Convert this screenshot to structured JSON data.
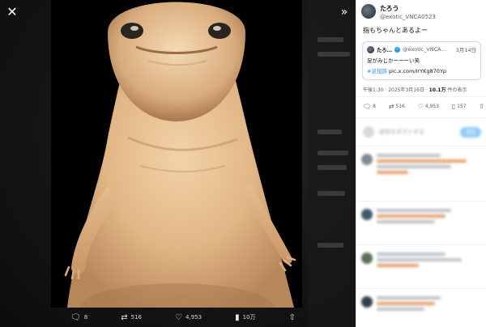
{
  "viewer": {
    "close_icon": "close-icon",
    "expand_icon": "chevron-right-double-icon",
    "media_actions": {
      "replies": "8",
      "retweets": "516",
      "likes": "4,953",
      "views": "10万"
    }
  },
  "sidebar": {
    "author": {
      "name": "たろう",
      "handle": "@exotic_VNCA0523"
    },
    "tweet_text": "指もちゃんとあるよー",
    "quote": {
      "name": "たろ…",
      "handle": "@exotic_VNCA…",
      "date": "3月14日",
      "line1": "足がみじかーーーい笑",
      "hashtag": "#足短族",
      "link": "pic.x.com/IrYKg870Yp"
    },
    "meta": {
      "time": "午後1:30 · 2025年3月16日 · ",
      "views_count": "10.1万",
      "views_label": " 件の表示"
    },
    "actions": {
      "replies": "8",
      "retweets": "516",
      "likes": "4,953",
      "bookmarks": "157"
    },
    "reply_box": {
      "placeholder": "返信をポストする",
      "button": "返信"
    }
  },
  "colors": {
    "accent": "#1d9bf0",
    "viewer_bg": "#111111"
  }
}
